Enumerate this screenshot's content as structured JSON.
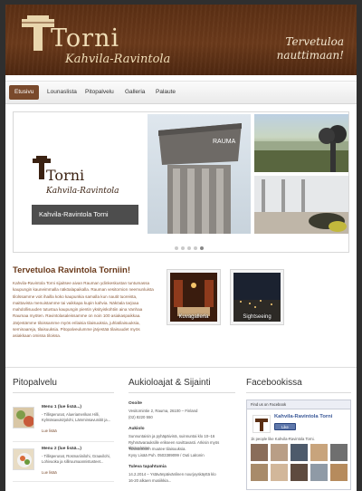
{
  "colors": {
    "brand_brown": "#6b3a1b",
    "nav_active": "#7a4a2c",
    "facebook_blue": "#3b5998"
  },
  "header": {
    "logo_name": "Torni",
    "logo_subtitle": "Kahvila-Ravintola",
    "welcome_line1": "Tervetuloa",
    "welcome_line2": "nauttimaan!"
  },
  "nav": {
    "items": [
      "Etusivu",
      "Lounaslista",
      "Pitopalvelu",
      "Galleria",
      "Palaute"
    ],
    "active": "Etusivu"
  },
  "slider": {
    "logo_name": "Torni",
    "logo_subtitle": "Kahvila-Ravintola",
    "caption": "Kahvila-Ravintola Torni",
    "tower_sign": "RAUMA",
    "slide_count": 5,
    "active_slide": 5
  },
  "intro": {
    "title": "Tervetuloa Ravintola Torniin!",
    "text": "Kahvila-Ravintola Torni sijaitsee aivan Rauman ydinkeskustan tuntumassa kaupungin kauneimmalla näköalapaikalla. Rauman vesitornion neemunluista tilolssamme voit ihailla koko kaupunkia samalla kun nautit tuoreista, maittavista menuistamme tai vaikkapa kupin kahvia. Näköala tarjoaa mahdollisuuden tutustua kaupungin pientin yksityiskohtiin aina Vanhaa Raumaa myöten. Ravintolasaleissamme on noin 100 asiakaspaikkaa. Järjestämme tiloissamme myös erilaisia tilaisuuksia, juhlatilaisuuksia, seminaareja, tilaisuuksia. Pitopalveulumme järjestää tilaisuudet myös asiakkaan omissa tiloissa."
  },
  "gallery": {
    "tile1_label": "Kuvagalleria",
    "tile2_label": "Sightseeing"
  },
  "columns": {
    "pito_title": "Pitopalvelu",
    "hours_title": "Aukioloajat & Sijainti",
    "facebook_title": "Facebookissa"
  },
  "menus": [
    {
      "title": "Menu 1 (lue lisää...)",
      "desc": "- Tillisperunat, Alueriamerikas Hilli, Kylmäsavukirjolohi, Lämminsavuniitit ja...",
      "link": "Lue lisää"
    },
    {
      "title": "Menu 2 (lue lisää...)",
      "desc": "- Tillisperunat, Rosmariinilohi, Graavilohi, Lohivuoka ja silliruumaannistusteet...",
      "link": "Lue lisää"
    }
  ],
  "info": {
    "address_head": "Osoite",
    "address_line1": "Vesitornintie 2, Rauma, 26100 – Finland",
    "address_line2": "(02) 8220 550",
    "hours_head": "Aukiolo",
    "hours_line1": "Sunnuntaisin ja pyhäpäivinä, suinnuntai klo 10–16",
    "hours_line2": "Ryhmävarauksille erikseen sovittavasti. Arkisin myös tilaisuuksien",
    "hours_line3": "Tilaisuuksien muutee tilaisuuksia.",
    "hours_line4": "Kysy Lisää Puh. 0503389099 / Outi Laitonin",
    "event_head": "Tuleva tapahtumia",
    "event_line1": "14.2.2014 – Ystävänpäivänlinen nourjoyskäyttä klo",
    "event_line2": "16-20 alkaen musiikkia..."
  },
  "facebook": {
    "bar_text": "Find us on Facebook",
    "page_name": "Kahvila-Ravintola Torni",
    "like_label": "Like",
    "likes_text": "1k people like Kahvila-Ravintola Torni."
  }
}
